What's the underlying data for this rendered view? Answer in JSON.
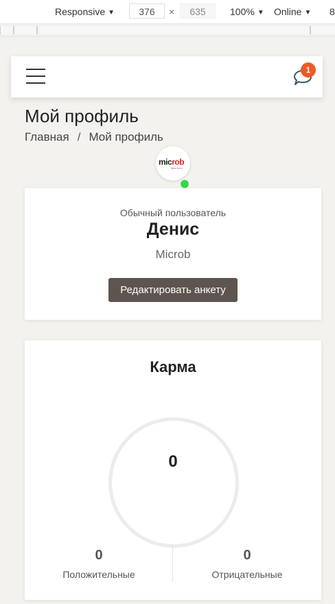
{
  "devtools": {
    "device": "Responsive",
    "width": "376",
    "height": "635",
    "zoom": "100%",
    "network": "Online",
    "extra": "8"
  },
  "header": {
    "menu_icon": "hamburger-icon",
    "chat_icon": "chat-bubble-icon",
    "notification_count": "1",
    "badge_color": "#ee5a24"
  },
  "page": {
    "title": "Мой профиль",
    "breadcrumb": {
      "home": "Главная",
      "separator": "/",
      "current": "Мой профиль"
    }
  },
  "profile": {
    "avatar_logo_part1": "mic",
    "avatar_logo_part2": "rob",
    "avatar_logo_tagline": "digital history",
    "online_color": "#35d84a",
    "role": "Обычный пользователь",
    "name": "Денис",
    "company": "Microb",
    "edit_button": "Редактировать анкету"
  },
  "karma": {
    "title": "Карма",
    "value": "0",
    "positive_value": "0",
    "positive_label": "Положительные",
    "negative_value": "0",
    "negative_label": "Отрицательные"
  }
}
